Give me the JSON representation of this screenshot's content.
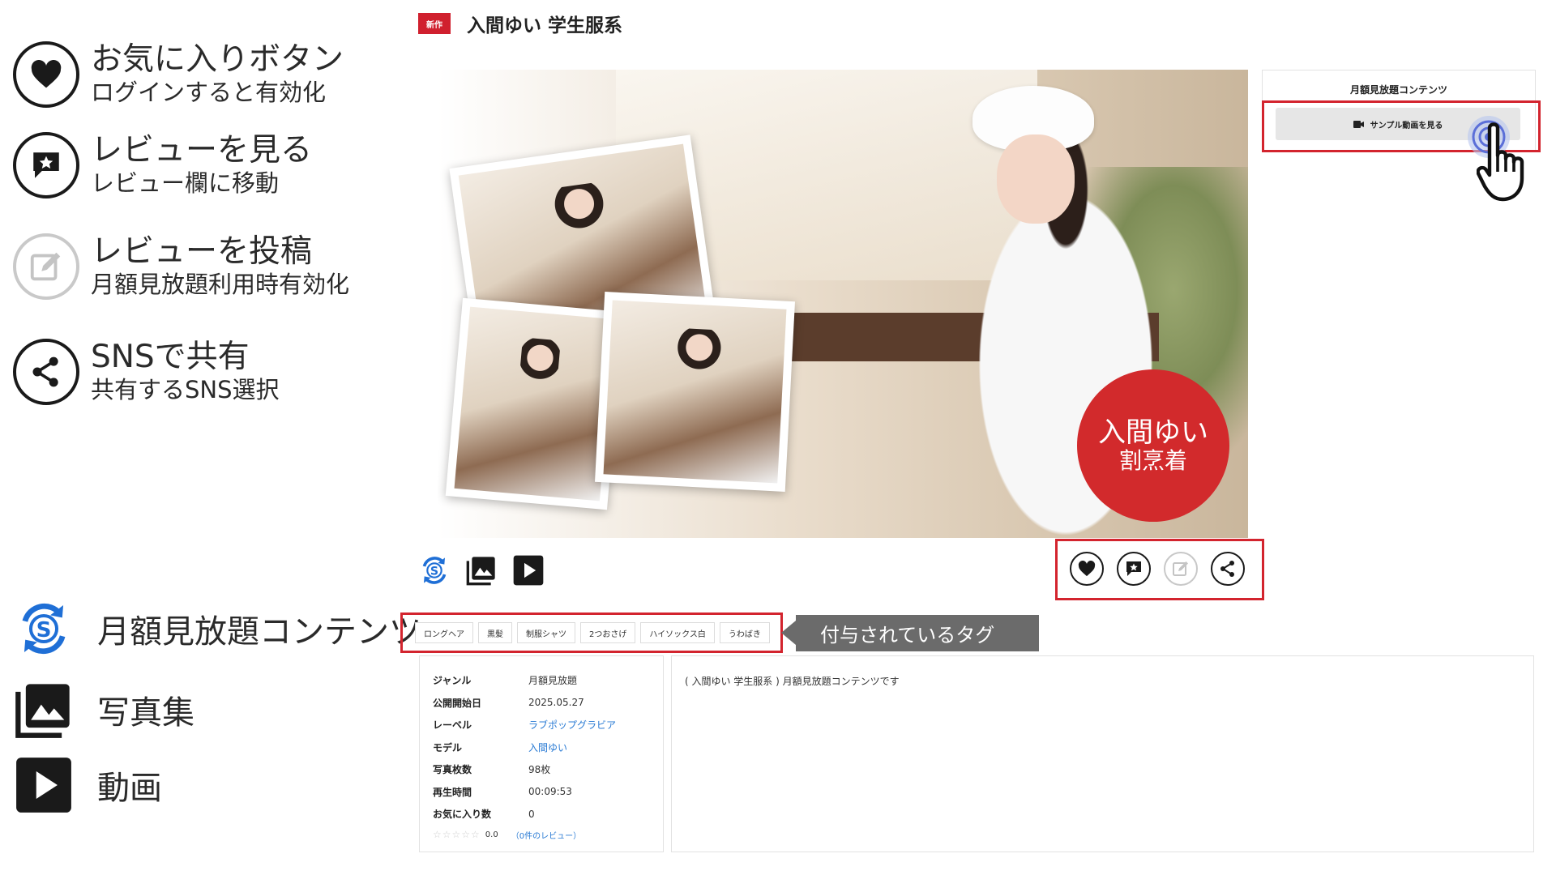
{
  "legend": [
    {
      "icon": "heart-icon",
      "title": "お気に入りボタン",
      "sub": "ログインすると有効化"
    },
    {
      "icon": "review-star-icon",
      "title": "レビューを見る",
      "sub": "レビュー欄に移動"
    },
    {
      "icon": "edit-review-icon",
      "title": "レビューを投稿",
      "sub": "月額見放題利用時有効化"
    },
    {
      "icon": "share-icon",
      "title": "SNSで共有",
      "sub": "共有するSNS選択"
    }
  ],
  "legend2": [
    {
      "icon": "subscription-icon",
      "label": "月額見放題コンテンツ"
    },
    {
      "icon": "photo-gallery-icon",
      "label": "写真集"
    },
    {
      "icon": "video-play-icon",
      "label": "動画"
    }
  ],
  "product": {
    "badge": "新作",
    "title": "入間ゆい 学生服系",
    "overlay_line1": "入間ゆい",
    "overlay_line2": "割烹着"
  },
  "side_box": {
    "title": "月額見放題コンテンツ",
    "sample_button": "サンプル動画を見る"
  },
  "tags": [
    "ロングヘア",
    "黒髪",
    "制服シャツ",
    "2つおさげ",
    "ハイソックス白",
    "うわばき"
  ],
  "tags_callout": "付与されているタグ",
  "info": [
    {
      "key": "ジャンル",
      "value": "月額見放題",
      "link": false
    },
    {
      "key": "公開開始日",
      "value": "2025.05.27",
      "link": false
    },
    {
      "key": "レーベル",
      "value": "ラブポップグラビア",
      "link": true
    },
    {
      "key": "モデル",
      "value": "入間ゆい",
      "link": true
    },
    {
      "key": "写真枚数",
      "value": "98枚",
      "link": false
    },
    {
      "key": "再生時間",
      "value": "00:09:53",
      "link": false
    },
    {
      "key": "お気に入り数",
      "value": "0",
      "link": false
    }
  ],
  "rating": {
    "stars": "☆☆☆☆☆",
    "score": "0.0",
    "reviews_link": "（0件のレビュー）"
  },
  "description": "( 入間ゆい 学生服系 ) 月額見放題コンテンツです",
  "colors": {
    "accent_red": "#d3242e",
    "link_blue": "#2a7bd4",
    "subscription_blue": "#1f6fd6"
  }
}
